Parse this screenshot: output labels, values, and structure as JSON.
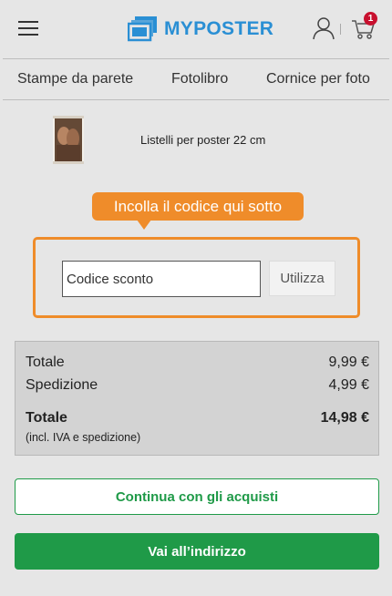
{
  "header": {
    "menu_icon": "hamburger-menu-icon",
    "logo_text": "MYPOSTER",
    "brand_color": "#2a8fd4",
    "user_icon": "user-icon",
    "cart_icon": "cart-icon",
    "cart_count": "1"
  },
  "nav": {
    "items": [
      {
        "label": "Stampe da parete"
      },
      {
        "label": "Fotolibro"
      },
      {
        "label": "Cornice per foto"
      }
    ]
  },
  "product": {
    "name": "Listelli per poster 22 cm"
  },
  "coupon": {
    "tooltip": "Incolla il codice qui sotto",
    "placeholder": "Codice sconto",
    "value": "",
    "button_label": "Utilizza",
    "accent_color": "#ef8c2a"
  },
  "summary": {
    "rows": [
      {
        "label": "Totale",
        "value": "9,99 €"
      },
      {
        "label": "Spedizione",
        "value": "4,99 €"
      }
    ],
    "total_label": "Totale",
    "total_value": "14,98 €",
    "total_note": "(incl. IVA e spedizione)"
  },
  "actions": {
    "continue_label": "Continua con gli acquisti",
    "address_label": "Vai all’indirizzo",
    "action_color": "#1f9a48"
  }
}
